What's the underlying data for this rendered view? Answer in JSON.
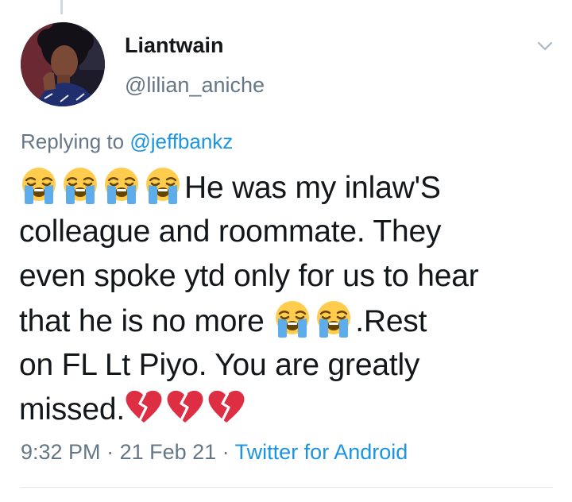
{
  "user": {
    "display_name": "Liantwain",
    "handle": "@lilian_aniche"
  },
  "reply": {
    "prefix": "Replying to ",
    "mention": "@jeffbankz"
  },
  "tweet": {
    "line1_text": "He was my inlaw'S",
    "line2_text": "colleague and roommate. They",
    "line3_text": "even spoke ytd only for us to hear",
    "line4_text": "that he is no more ",
    "line4_after": ".Rest",
    "line5_text": "on FL Lt Piyo. You are greatly",
    "line6_text": "missed."
  },
  "meta": {
    "time": "9:32 PM",
    "sep1": " · ",
    "date": "21 Feb 21",
    "sep2": " · ",
    "source": "Twitter for Android"
  },
  "icons": {
    "crying_emoji": "loudly-crying-face-icon",
    "broken_heart": "broken-heart-icon",
    "chevron": "chevron-down-icon"
  },
  "colors": {
    "name": "#14171a",
    "secondary": "#657786",
    "link": "#1b95e0",
    "divider": "#e1e8ed"
  }
}
